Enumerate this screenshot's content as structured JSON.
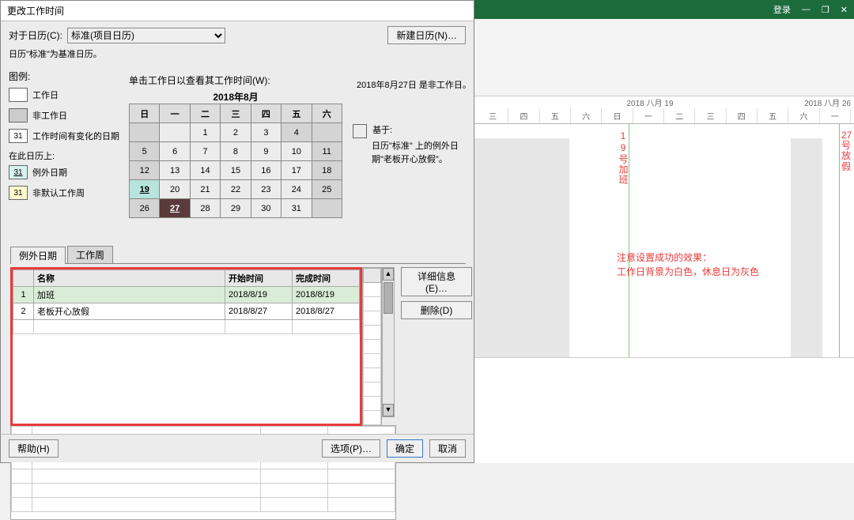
{
  "dialog": {
    "title": "更改工作时间",
    "for_calendar_label": "对于日历(C):",
    "selected_calendar": "标准(项目日历)",
    "new_calendar_btn": "新建日历(N)…",
    "base_calendar_text": "日历\"标准\"为基准日历。",
    "legend_title": "图例:",
    "legend": {
      "work": "工作日",
      "nonwork": "非工作日",
      "changed": "工作时间有变化的日期",
      "on_this_calendar": "在此日历上:",
      "exception": "例外日期",
      "nondefault": "非默认工作周"
    },
    "swatch_num": "31",
    "calendar_caption": "单击工作日以查看其工作时间(W):",
    "calendar_month": "2018年8月",
    "weekdays": [
      "日",
      "一",
      "二",
      "三",
      "四",
      "五",
      "六"
    ],
    "calendar": [
      [
        "",
        "",
        "1",
        "2",
        "3",
        "4"
      ],
      [
        "5",
        "6",
        "7",
        "8",
        "9",
        "10",
        "11"
      ],
      [
        "12",
        "13",
        "14",
        "15",
        "16",
        "17",
        "18"
      ],
      [
        "19",
        "20",
        "21",
        "22",
        "23",
        "24",
        "25"
      ],
      [
        "26",
        "27",
        "28",
        "29",
        "30",
        "31",
        ""
      ]
    ],
    "highlight_teal": "19",
    "highlight_dark": "27",
    "date_status": "2018年8月27日 是非工作日。",
    "based_on_label": "基于:",
    "based_on_text": "日历\"标准\" 上的例外日期\"老板开心放假\"。",
    "tabs": {
      "exceptions": "例外日期",
      "workweeks": "工作周"
    },
    "exc_headers": {
      "name": "名称",
      "start": "开始时间",
      "finish": "完成时间"
    },
    "exceptions": [
      {
        "idx": "1",
        "name": "加班",
        "start": "2018/8/19",
        "finish": "2018/8/19"
      },
      {
        "idx": "2",
        "name": "老板开心放假",
        "start": "2018/8/27",
        "finish": "2018/8/27"
      }
    ],
    "details_btn": "详细信息(E)…",
    "delete_btn": "删除(D)",
    "help_btn": "帮助(H)",
    "options_btn": "选项(P)…",
    "ok_btn": "确定",
    "cancel_btn": "取消"
  },
  "project": {
    "login": "登录",
    "timeline_left": "2018 八月 19",
    "timeline_right": "2018 八月 26",
    "days": [
      "三",
      "四",
      "五",
      "六",
      "日",
      "一",
      "二",
      "三",
      "四",
      "五",
      "六",
      "一"
    ],
    "task1": "19号加班",
    "task2": "27号放假",
    "note_line1": "注意设置成功的效果：",
    "note_line2": "工作日背景为白色，休息日为灰色"
  }
}
